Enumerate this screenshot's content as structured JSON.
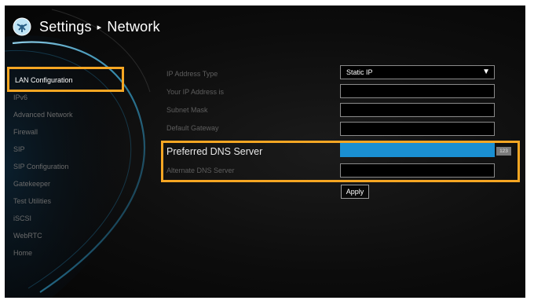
{
  "header": {
    "section": "Settings",
    "separator": "▸",
    "page": "Network"
  },
  "sidebar": {
    "items": [
      {
        "label": "LAN Configuration",
        "active": true
      },
      {
        "label": "IPv6"
      },
      {
        "label": "Advanced Network"
      },
      {
        "label": "Firewall"
      },
      {
        "label": "SIP"
      },
      {
        "label": "SIP Configuration"
      },
      {
        "label": "Gatekeeper"
      },
      {
        "label": "Test Utilities"
      },
      {
        "label": "iSCSI"
      },
      {
        "label": "WebRTC"
      },
      {
        "label": "Home"
      }
    ]
  },
  "form": {
    "ip_address_type": {
      "label": "IP Address Type",
      "value": "Static IP",
      "arrow": "▼"
    },
    "your_ip": {
      "label": "Your IP Address is",
      "value": ""
    },
    "subnet_mask": {
      "label": "Subnet Mask",
      "value": ""
    },
    "default_gateway": {
      "label": "Default Gateway",
      "value": ""
    },
    "preferred_dns": {
      "label": "Preferred DNS Server",
      "value": "",
      "input_mode": "123"
    },
    "alternate_dns": {
      "label": "Alternate DNS Server",
      "value": ""
    },
    "apply_label": "Apply"
  },
  "colors": {
    "highlight": "#f5a623",
    "focus_field": "#1a8fd2",
    "background": "#0d0d0d"
  },
  "icons": {
    "logo": "globe-logo-icon",
    "dropdown": "triangle-down-icon"
  }
}
